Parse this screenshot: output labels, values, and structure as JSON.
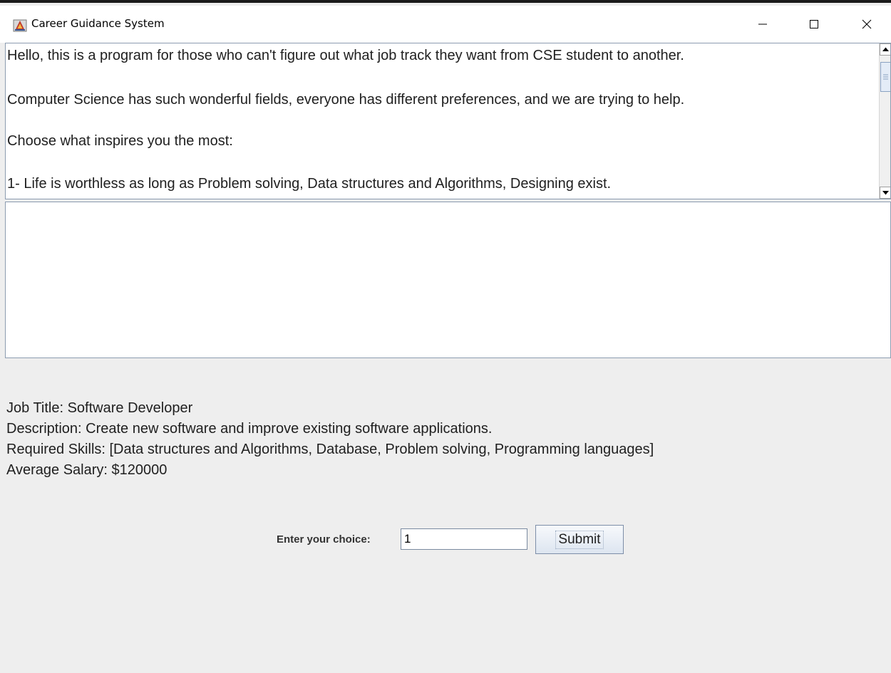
{
  "window": {
    "title": "Career Guidance System",
    "app_icon": "java-app-icon",
    "controls": [
      "minimize-icon",
      "maximize-icon",
      "close-icon"
    ]
  },
  "prompt_text": {
    "lines": [
      "Hello, this is a program for those who can't figure out what job track they want from CSE student to another.",
      "Computer Science has such wonderful fields, everyone has different preferences, and we are trying to help.",
      "Choose what inspires you the most:",
      "1- Life is worthless as long as Problem solving, Data structures and Algorithms, Designing exist."
    ]
  },
  "output_text": "",
  "job_info": {
    "title_line": "Job Title: Software Developer",
    "description_line": "Description: Create new software and improve existing software applications.",
    "skills_line": "Required Skills: [Data structures and Algorithms, Database, Problem solving, Programming languages]",
    "salary_line": "Average Salary: $120000"
  },
  "input_row": {
    "label": "Enter your choice:",
    "value": "1",
    "submit_label": "Submit"
  },
  "colors": {
    "window_bg": "#eeeeee",
    "field_border": "#8c9cb0",
    "button_border": "#7d8ea8"
  }
}
